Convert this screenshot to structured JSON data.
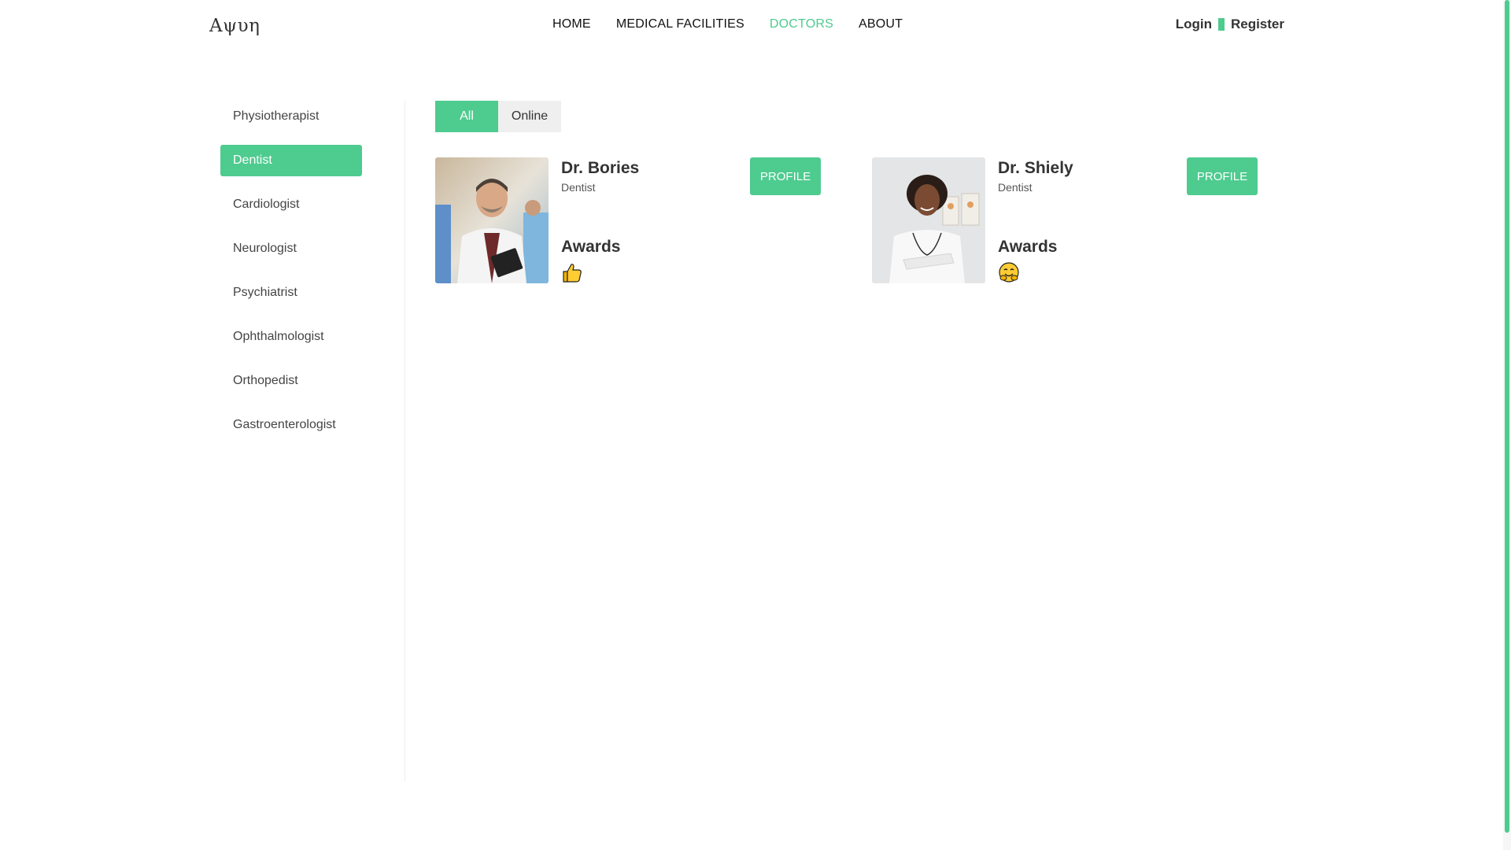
{
  "header": {
    "logo": "Αψυη",
    "nav": [
      "HOME",
      "MEDICAL FACILITIES",
      "DOCTORS",
      "ABOUT"
    ],
    "active_nav": "DOCTORS",
    "login": "Login",
    "register": "Register"
  },
  "sidebar": {
    "items": [
      "Physiotherapist",
      "Dentist",
      "Cardiologist",
      "Neurologist",
      "Psychiatrist",
      "Ophthalmologist",
      "Orthopedist",
      "Gastroenterologist"
    ],
    "active": "Dentist"
  },
  "filters": {
    "all": "All",
    "online": "Online"
  },
  "doctors": [
    {
      "name": "Dr. Bories",
      "specialty": "Dentist",
      "awards_label": "Awards",
      "award_icon": "thumbs-up-icon",
      "profile": "PROFILE"
    },
    {
      "name": "Dr. Shiely",
      "specialty": "Dentist",
      "awards_label": "Awards",
      "award_icon": "hugging-face-icon",
      "profile": "PROFILE"
    }
  ],
  "colors": {
    "accent": "#4ecb8f",
    "text": "#333333"
  }
}
